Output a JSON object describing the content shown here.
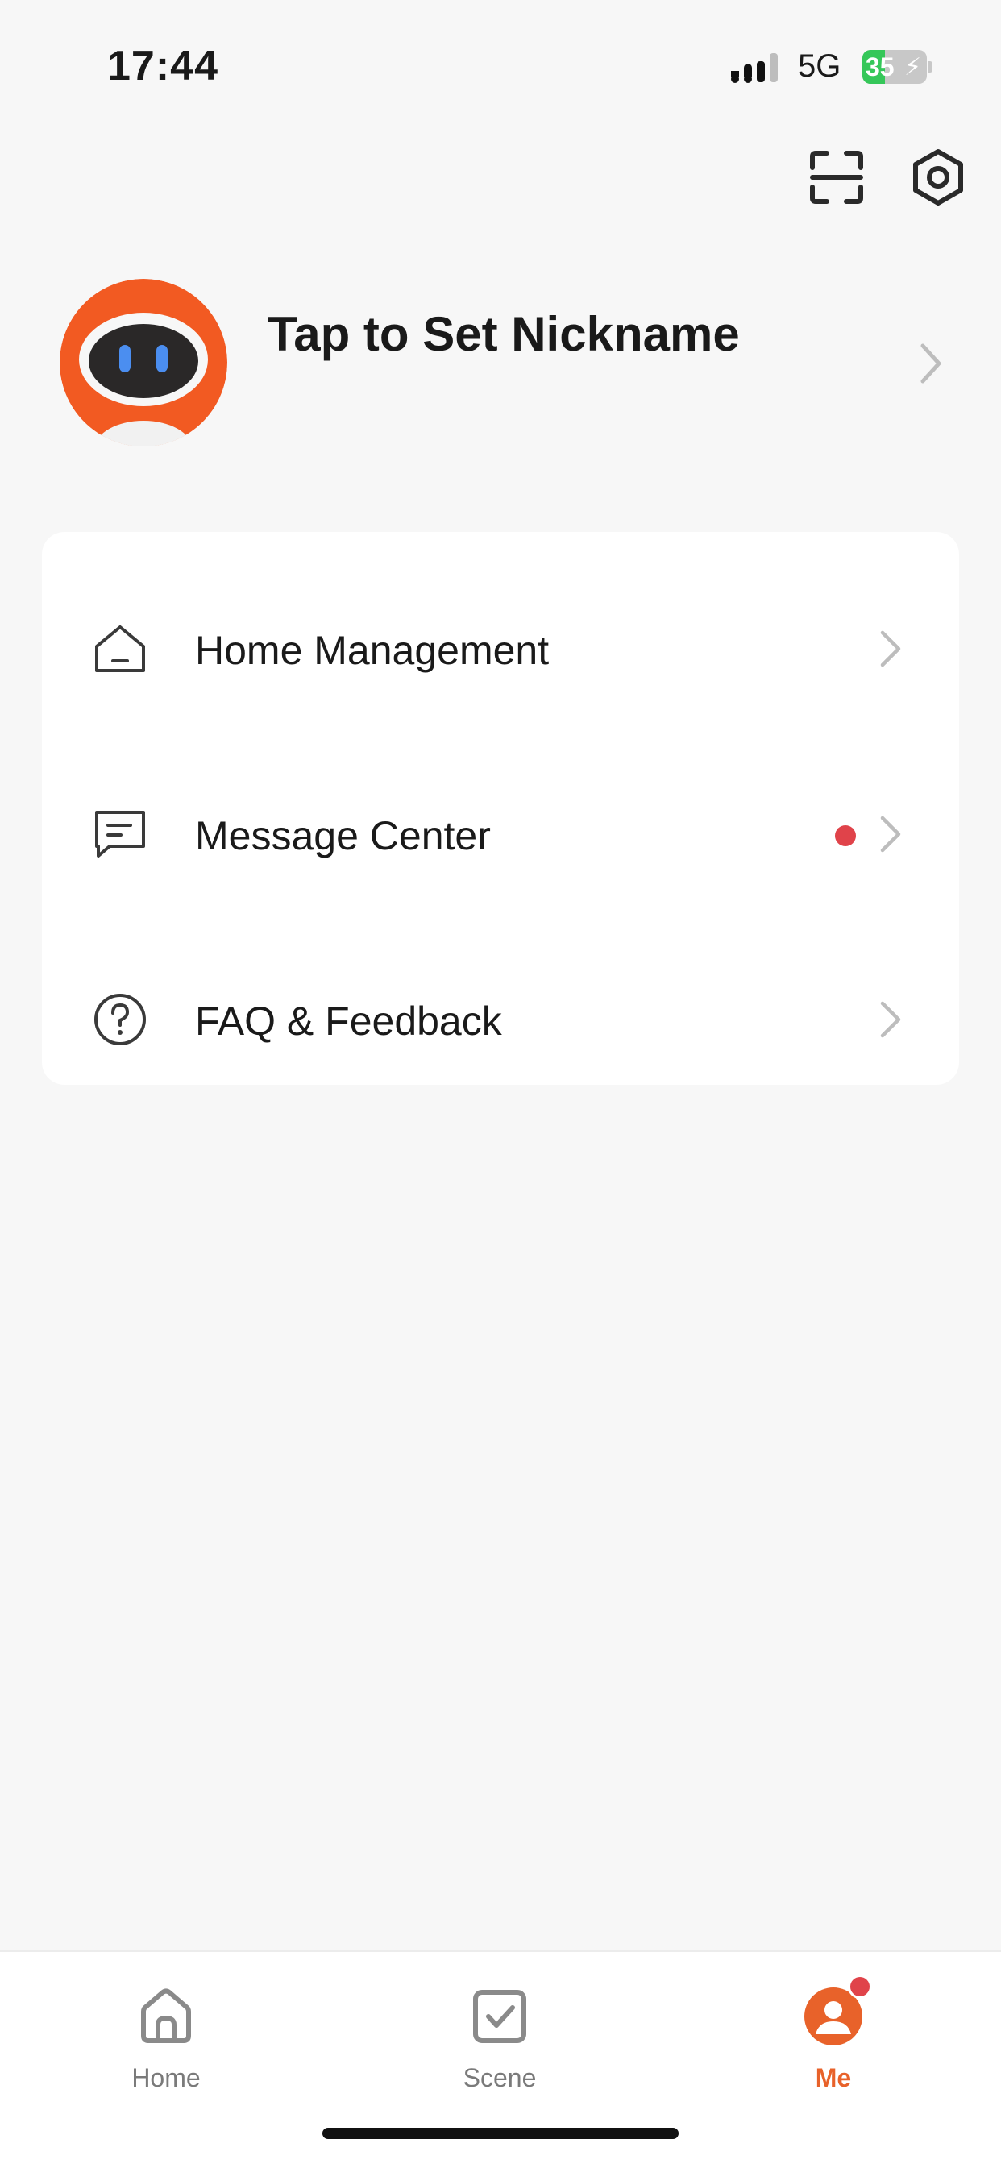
{
  "status_bar": {
    "time": "17:44",
    "network": "5G",
    "battery_percent": 35,
    "battery_text": "35"
  },
  "top_actions": {
    "scan_icon": "scan-icon",
    "settings_icon": "gear-icon"
  },
  "profile": {
    "nickname": "Tap to Set Nickname"
  },
  "menu": {
    "items": [
      {
        "label": "Home Management",
        "icon": "house-icon",
        "has_dot": false
      },
      {
        "label": "Message Center",
        "icon": "message-icon",
        "has_dot": true
      },
      {
        "label": "FAQ & Feedback",
        "icon": "question-icon",
        "has_dot": false
      }
    ]
  },
  "tab_bar": {
    "tabs": [
      {
        "label": "Home",
        "icon": "home-icon",
        "active": false
      },
      {
        "label": "Scene",
        "icon": "scene-checkbox-icon",
        "active": false
      },
      {
        "label": "Me",
        "icon": "profile-icon",
        "active": true,
        "badge": true
      }
    ]
  },
  "colors": {
    "accent": "#e8622a",
    "badge": "#e0434a",
    "background": "#f7f7f7",
    "card": "#ffffff",
    "text": "#1a1a1a",
    "muted": "#7a7a7a",
    "battery": "#35c759"
  }
}
